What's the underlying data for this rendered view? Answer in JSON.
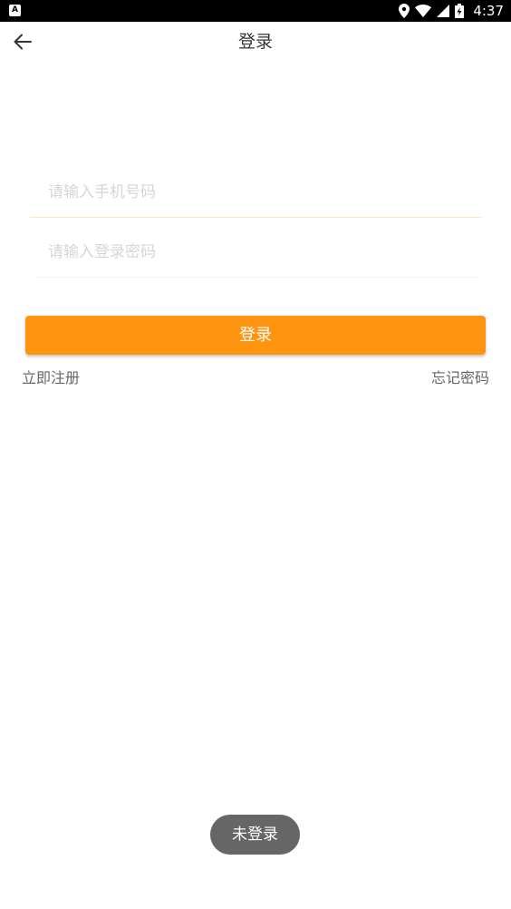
{
  "status_bar": {
    "app_icon_letter": "A",
    "time": "4:37",
    "icons": [
      "location-icon",
      "wifi-icon",
      "signal-icon",
      "battery-icon"
    ]
  },
  "toolbar": {
    "back_icon": "arrow-left-icon",
    "title": "登录"
  },
  "form": {
    "phone": {
      "placeholder": "请输入手机号码",
      "value": ""
    },
    "password": {
      "placeholder": "请输入登录密码",
      "value": ""
    },
    "login_button": "登录",
    "register_link": "立即注册",
    "forgot_link": "忘记密码"
  },
  "toast": {
    "text": "未登录"
  },
  "colors": {
    "accent": "#fe9410",
    "status_bar": "#000000",
    "text_primary": "#333333",
    "text_secondary": "#666666",
    "placeholder": "#d6d6d6",
    "toast_bg": "#666666"
  }
}
